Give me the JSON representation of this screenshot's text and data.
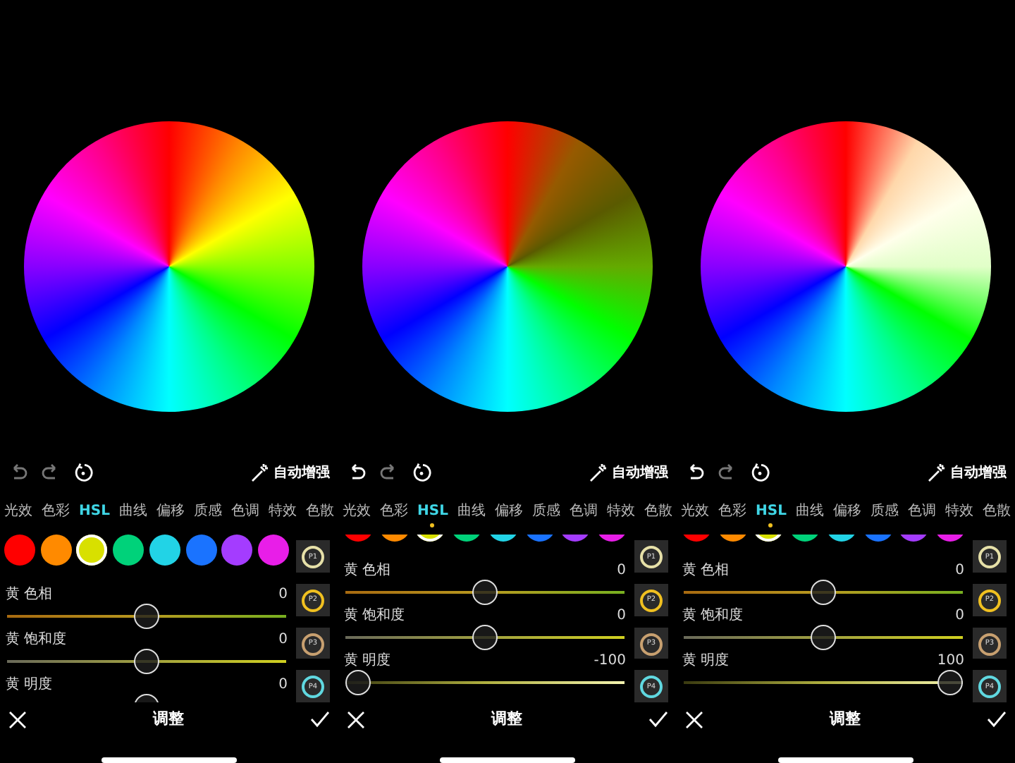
{
  "panels": [
    {
      "toolbar": {
        "undo": {
          "disabled": true
        },
        "redo": {
          "disabled": true
        },
        "auto_label": "自动增强"
      },
      "tabs": [
        {
          "label": "光效",
          "selected": false
        },
        {
          "label": "色彩",
          "selected": false
        },
        {
          "label": "HSL",
          "selected": true
        },
        {
          "label": "曲线",
          "selected": false
        },
        {
          "label": "偏移",
          "selected": false
        },
        {
          "label": "质感",
          "selected": false
        },
        {
          "label": "色调",
          "selected": false
        },
        {
          "label": "特效",
          "selected": false
        },
        {
          "label": "色散",
          "selected": false
        }
      ],
      "tab_indicator": false,
      "swatches_scrolled": false,
      "swatches": [
        {
          "color": "#ff0000",
          "selected": false
        },
        {
          "color": "#ff8a00",
          "selected": false
        },
        {
          "color": "#d8e000",
          "selected": true
        },
        {
          "color": "#00d27a",
          "selected": false
        },
        {
          "color": "#22d3e6",
          "selected": false
        },
        {
          "color": "#1a73ff",
          "selected": false
        },
        {
          "color": "#a43cff",
          "selected": false
        },
        {
          "color": "#e81ee8",
          "selected": false
        }
      ],
      "sliders": [
        {
          "kind": "hue",
          "label": "黄 色相",
          "value": "0",
          "level": 0.5
        },
        {
          "kind": "saturation",
          "label": "黄 饱和度",
          "value": "0",
          "level": 0.5
        },
        {
          "kind": "lightness",
          "label": "黄 明度",
          "value": "0",
          "level": 0.5
        }
      ],
      "presets": [
        {
          "label": "P1",
          "color": "#e6e0a8"
        },
        {
          "label": "P2",
          "color": "#f0c020"
        },
        {
          "label": "P3",
          "color": "#c8a070"
        },
        {
          "label": "P4",
          "color": "#60d8e0"
        }
      ],
      "bottom_title": "调整"
    },
    {
      "toolbar": {
        "undo": {
          "disabled": false
        },
        "redo": {
          "disabled": true
        },
        "auto_label": "自动增强"
      },
      "tabs": [
        {
          "label": "光效",
          "selected": false
        },
        {
          "label": "色彩",
          "selected": false
        },
        {
          "label": "HSL",
          "selected": true
        },
        {
          "label": "曲线",
          "selected": false
        },
        {
          "label": "偏移",
          "selected": false
        },
        {
          "label": "质感",
          "selected": false
        },
        {
          "label": "色调",
          "selected": false
        },
        {
          "label": "特效",
          "selected": false
        },
        {
          "label": "色散",
          "selected": false
        }
      ],
      "tab_indicator": true,
      "swatches_scrolled": true,
      "swatches": [
        {
          "color": "#ff0000",
          "selected": false
        },
        {
          "color": "#ff8a00",
          "selected": false
        },
        {
          "color": "#d8e000",
          "selected": true
        },
        {
          "color": "#00d27a",
          "selected": false
        },
        {
          "color": "#22d3e6",
          "selected": false
        },
        {
          "color": "#1a73ff",
          "selected": false
        },
        {
          "color": "#a43cff",
          "selected": false
        },
        {
          "color": "#e81ee8",
          "selected": false
        }
      ],
      "sliders": [
        {
          "kind": "hue",
          "label": "黄 色相",
          "value": "0",
          "level": 0.5
        },
        {
          "kind": "saturation",
          "label": "黄 饱和度",
          "value": "0",
          "level": 0.5
        },
        {
          "kind": "lightness",
          "label": "黄 明度",
          "value": "-100",
          "level": 0
        }
      ],
      "presets": [
        {
          "label": "P1",
          "color": "#e6e0a8"
        },
        {
          "label": "P2",
          "color": "#f0c020"
        },
        {
          "label": "P3",
          "color": "#c8a070"
        },
        {
          "label": "P4",
          "color": "#60d8e0"
        }
      ],
      "bottom_title": "调整"
    },
    {
      "toolbar": {
        "undo": {
          "disabled": false
        },
        "redo": {
          "disabled": true
        },
        "auto_label": "自动增强"
      },
      "tabs": [
        {
          "label": "光效",
          "selected": false
        },
        {
          "label": "色彩",
          "selected": false
        },
        {
          "label": "HSL",
          "selected": true
        },
        {
          "label": "曲线",
          "selected": false
        },
        {
          "label": "偏移",
          "selected": false
        },
        {
          "label": "质感",
          "selected": false
        },
        {
          "label": "色调",
          "selected": false
        },
        {
          "label": "特效",
          "selected": false
        },
        {
          "label": "色散",
          "selected": false
        }
      ],
      "tab_indicator": true,
      "swatches_scrolled": true,
      "swatches": [
        {
          "color": "#ff0000",
          "selected": false
        },
        {
          "color": "#ff8a00",
          "selected": false
        },
        {
          "color": "#d8e000",
          "selected": true
        },
        {
          "color": "#00d27a",
          "selected": false
        },
        {
          "color": "#22d3e6",
          "selected": false
        },
        {
          "color": "#1a73ff",
          "selected": false
        },
        {
          "color": "#a43cff",
          "selected": false
        },
        {
          "color": "#e81ee8",
          "selected": false
        }
      ],
      "sliders": [
        {
          "kind": "hue",
          "label": "黄 色相",
          "value": "0",
          "level": 0.5
        },
        {
          "kind": "saturation",
          "label": "黄 饱和度",
          "value": "0",
          "level": 0.5
        },
        {
          "kind": "lightness",
          "label": "黄 明度",
          "value": "100",
          "level": 1
        }
      ],
      "presets": [
        {
          "label": "P1",
          "color": "#e6e0a8"
        },
        {
          "label": "P2",
          "color": "#f0c020"
        },
        {
          "label": "P3",
          "color": "#c8a070"
        },
        {
          "label": "P4",
          "color": "#60d8e0"
        }
      ],
      "bottom_title": "调整"
    }
  ]
}
